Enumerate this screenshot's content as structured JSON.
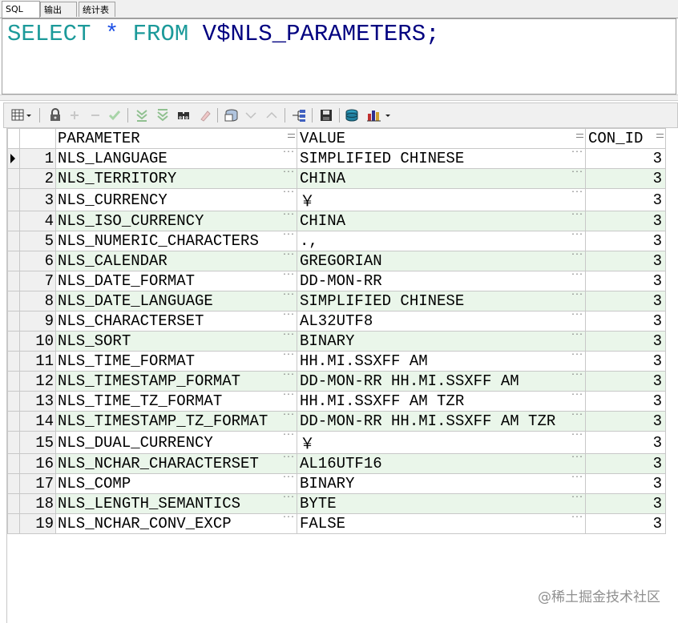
{
  "tabs": [
    {
      "label": "SQL"
    },
    {
      "label": "输出"
    },
    {
      "label": "统计表"
    }
  ],
  "editor": {
    "tokens": {
      "select": "SELECT",
      "star": "*",
      "from": "FROM",
      "table": "V$NLS_PARAMETERS",
      "semi": ";"
    }
  },
  "toolbar": {
    "icons": [
      "grid-view-icon",
      "lock-icon",
      "add-icon",
      "remove-icon",
      "check-icon",
      "filter-down-icon",
      "filter-up-icon",
      "find-icon",
      "clear-icon",
      "query-icon",
      "down-icon",
      "up-icon",
      "connect-icon",
      "save-icon",
      "export-icon",
      "chart-icon"
    ]
  },
  "grid": {
    "columns": [
      "PARAMETER",
      "VALUE",
      "CON_ID"
    ],
    "rows": [
      {
        "num": "1",
        "parameter": "NLS_LANGUAGE",
        "value": "SIMPLIFIED CHINESE",
        "con_id": "3"
      },
      {
        "num": "2",
        "parameter": "NLS_TERRITORY",
        "value": "CHINA",
        "con_id": "3"
      },
      {
        "num": "3",
        "parameter": "NLS_CURRENCY",
        "value": "￥",
        "con_id": "3"
      },
      {
        "num": "4",
        "parameter": "NLS_ISO_CURRENCY",
        "value": "CHINA",
        "con_id": "3"
      },
      {
        "num": "5",
        "parameter": "NLS_NUMERIC_CHARACTERS",
        "value": ".,",
        "con_id": "3"
      },
      {
        "num": "6",
        "parameter": "NLS_CALENDAR",
        "value": "GREGORIAN",
        "con_id": "3"
      },
      {
        "num": "7",
        "parameter": "NLS_DATE_FORMAT",
        "value": "DD-MON-RR",
        "con_id": "3"
      },
      {
        "num": "8",
        "parameter": "NLS_DATE_LANGUAGE",
        "value": "SIMPLIFIED CHINESE",
        "con_id": "3"
      },
      {
        "num": "9",
        "parameter": "NLS_CHARACTERSET",
        "value": "AL32UTF8",
        "con_id": "3"
      },
      {
        "num": "10",
        "parameter": "NLS_SORT",
        "value": "BINARY",
        "con_id": "3"
      },
      {
        "num": "11",
        "parameter": "NLS_TIME_FORMAT",
        "value": "HH.MI.SSXFF AM",
        "con_id": "3"
      },
      {
        "num": "12",
        "parameter": "NLS_TIMESTAMP_FORMAT",
        "value": "DD-MON-RR HH.MI.SSXFF AM",
        "con_id": "3"
      },
      {
        "num": "13",
        "parameter": "NLS_TIME_TZ_FORMAT",
        "value": "HH.MI.SSXFF AM TZR",
        "con_id": "3"
      },
      {
        "num": "14",
        "parameter": "NLS_TIMESTAMP_TZ_FORMAT",
        "value": "DD-MON-RR HH.MI.SSXFF AM TZR",
        "con_id": "3"
      },
      {
        "num": "15",
        "parameter": "NLS_DUAL_CURRENCY",
        "value": "￥",
        "con_id": "3"
      },
      {
        "num": "16",
        "parameter": "NLS_NCHAR_CHARACTERSET",
        "value": "AL16UTF16",
        "con_id": "3"
      },
      {
        "num": "17",
        "parameter": "NLS_COMP",
        "value": "BINARY",
        "con_id": "3"
      },
      {
        "num": "18",
        "parameter": "NLS_LENGTH_SEMANTICS",
        "value": "BYTE",
        "con_id": "3"
      },
      {
        "num": "19",
        "parameter": "NLS_NCHAR_CONV_EXCP",
        "value": "FALSE",
        "con_id": "3"
      }
    ]
  },
  "watermark": "@稀土掘金技术社区",
  "colors": {
    "keyword": "#1c9a9a",
    "star": "#1c4fe6",
    "identifier": "#000080",
    "row_alt": "#eaf6ea"
  }
}
